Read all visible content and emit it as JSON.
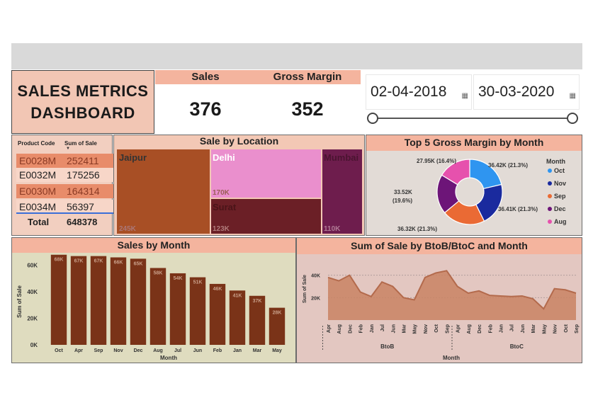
{
  "header": {
    "title_line1": "SALES METRICS",
    "title_line2": "DASHBOARD"
  },
  "kpis": {
    "sales_label": "Sales",
    "sales_value": "376",
    "margin_label": "Gross Margin",
    "margin_value": "352"
  },
  "date_range": {
    "start": "02-04-2018",
    "end": "30-03-2020",
    "calendar_icon": "calendar-icon"
  },
  "table": {
    "col1": "Product Code",
    "col2": "Sum of Sale",
    "sort_icon": "sort-desc-icon",
    "rows": [
      {
        "code": "E0028M",
        "value": "252411"
      },
      {
        "code": "E0032M",
        "value": "175256"
      },
      {
        "code": "E0030M",
        "value": "164314"
      },
      {
        "code": "E0034M",
        "value": "56397"
      }
    ],
    "total_label": "Total",
    "total_value": "648378"
  },
  "treemap": {
    "title": "Sale by Location",
    "items": [
      {
        "name": "Jaipur",
        "value": "245K",
        "color": "#a84f25"
      },
      {
        "name": "Delhi",
        "value": "170K",
        "color": "#ea8fcd"
      },
      {
        "name": "Surat",
        "value": "123K",
        "color": "#6b1f26"
      },
      {
        "name": "Mumbai",
        "value": "110K",
        "color": "#6e1d4d"
      }
    ]
  },
  "donut": {
    "title": "Top 5 Gross Margin by Month",
    "legend_title": "Month",
    "slices": [
      {
        "month": "Oct",
        "label": "36.42K (21.3%)",
        "value": 36.42,
        "color": "#2f95f0"
      },
      {
        "month": "Nov",
        "label": "36.41K (21.3%)",
        "value": 36.41,
        "color": "#1a2a9e"
      },
      {
        "month": "Sep",
        "label": "36.32K (21.3%)",
        "value": 36.32,
        "color": "#ea6a34"
      },
      {
        "month": "Dec",
        "label": "33.52K (19.6%)",
        "value": 33.52,
        "color": "#6d1578"
      },
      {
        "month": "Aug",
        "label": "27.95K (16.4%)",
        "value": 27.95,
        "color": "#e651ad"
      }
    ]
  },
  "chart_data": [
    {
      "type": "bar",
      "title": "Sales by Month",
      "xlabel": "Month",
      "ylabel": "Sum of Sale",
      "categories": [
        "Oct",
        "Apr",
        "Sep",
        "Nov",
        "Dec",
        "Aug",
        "Jul",
        "Jun",
        "Feb",
        "Jan",
        "Mar",
        "May"
      ],
      "values": [
        68000,
        67000,
        67000,
        66000,
        65000,
        58000,
        54000,
        51000,
        46000,
        41000,
        37000,
        28000
      ],
      "data_labels": [
        "68K",
        "67K",
        "67K",
        "66K",
        "65K",
        "58K",
        "54K",
        "51K",
        "46K",
        "41K",
        "37K",
        "28K"
      ],
      "yticks": [
        "0K",
        "20K",
        "40K",
        "60K"
      ],
      "ylim": [
        0,
        70000
      ],
      "color": "#7a3318"
    },
    {
      "type": "area",
      "title": "Sum of Sale by BtoB/BtoC and Month",
      "xlabel": "Month",
      "ylabel": "Sum of Sale",
      "groups": [
        {
          "name": "BtoB",
          "categories": [
            "Apr",
            "Aug",
            "Dec",
            "Feb",
            "Jan",
            "Jul",
            "Jun",
            "Mar",
            "May",
            "Nov",
            "Oct",
            "Sep"
          ]
        },
        {
          "name": "BtoC",
          "categories": [
            "Apr",
            "Aug",
            "Dec",
            "Feb",
            "Jan",
            "Jul",
            "Jun",
            "Mar",
            "May",
            "Nov",
            "Oct",
            "Sep"
          ]
        }
      ],
      "values": [
        38000,
        35000,
        40000,
        25000,
        21000,
        34000,
        30000,
        20000,
        18000,
        38000,
        42000,
        44000,
        30000,
        24000,
        26000,
        22000,
        21500,
        21000,
        21500,
        19000,
        10000,
        28000,
        27000,
        24000
      ],
      "yticks": [
        "20K",
        "40K"
      ],
      "ylim": [
        0,
        48000
      ],
      "color": "#c98263"
    }
  ]
}
